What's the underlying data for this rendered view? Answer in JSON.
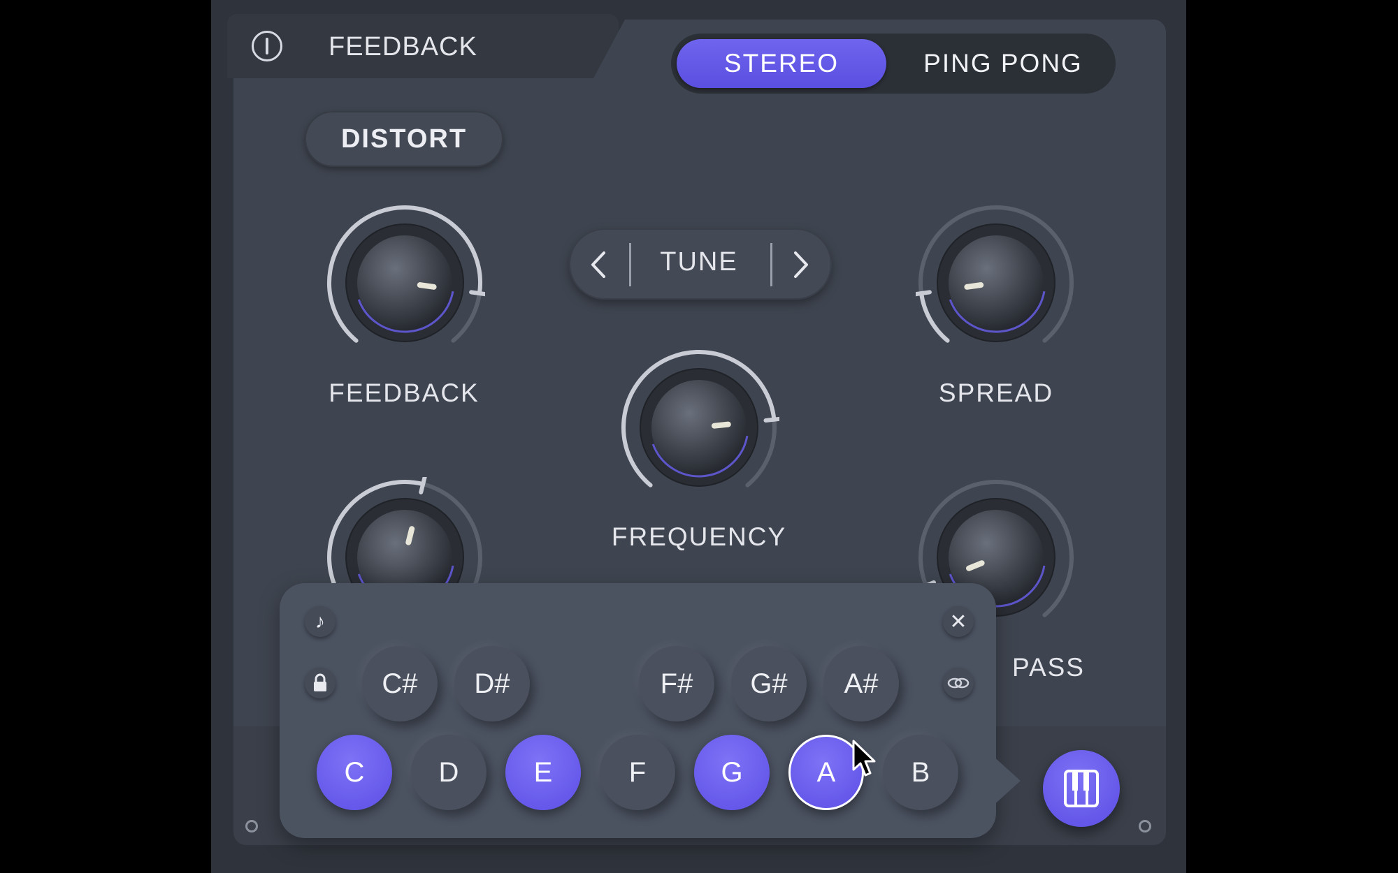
{
  "header": {
    "power_icon": "power-icon",
    "title": "FEEDBACK",
    "mode_options": [
      "STEREO",
      "PING PONG"
    ],
    "mode_selected": "STEREO"
  },
  "distort_label": "DISTORT",
  "tune": {
    "prev_icon": "chevron-left-icon",
    "label": "TUNE",
    "next_icon": "chevron-right-icon"
  },
  "knobs": {
    "feedback": {
      "label": "FEEDBACK",
      "level": 0.85
    },
    "frequency": {
      "label": "FREQUENCY",
      "level": 0.8
    },
    "spread": {
      "label": "SPREAD",
      "level": 0.15
    },
    "low_left": {
      "label": "",
      "level": 0.55
    },
    "pass": {
      "label": "PASS",
      "level": 0.1
    }
  },
  "note_picker": {
    "note_icon": "music-note-icon",
    "lock_icon": "lock-icon",
    "link_icon": "link-icon",
    "close_icon": "close-icon",
    "sharps": [
      "C#",
      "D#",
      "F#",
      "G#",
      "A#"
    ],
    "naturals": [
      "C",
      "D",
      "E",
      "F",
      "G",
      "A",
      "B"
    ],
    "active_notes": [
      "C",
      "E",
      "G",
      "A"
    ],
    "focused_note": "A"
  },
  "piano_icon": "piano-keys-icon",
  "colors": {
    "accent": "#6a5ff0",
    "panel": "#3f4550",
    "background": "#2f333b"
  }
}
